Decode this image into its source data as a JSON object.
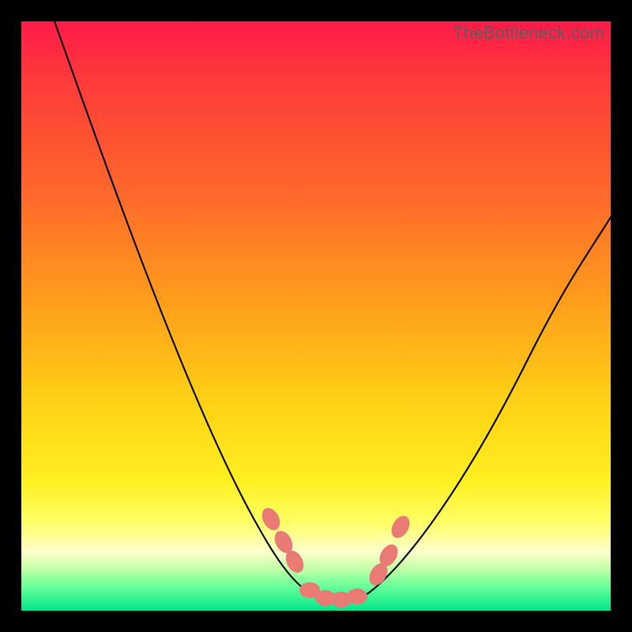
{
  "watermark": "TheBottleneck.com",
  "colors": {
    "background": "#000000",
    "curve": "#000000",
    "marker": "#ea7a74"
  },
  "chart_data": {
    "type": "line",
    "title": "",
    "xlabel": "",
    "ylabel": "",
    "xlim": [
      0,
      100
    ],
    "ylim": [
      0,
      100
    ],
    "series": [
      {
        "name": "curve",
        "x": [
          5,
          10,
          15,
          20,
          25,
          30,
          35,
          40,
          43,
          46,
          48,
          50,
          52,
          54,
          56,
          60,
          65,
          70,
          75,
          80,
          85,
          90,
          95,
          100
        ],
        "y": [
          100,
          88,
          77,
          66,
          55,
          44,
          33,
          22,
          15,
          10,
          6,
          3,
          2,
          2,
          3,
          5,
          10,
          17,
          25,
          33,
          42,
          50,
          58,
          68
        ]
      }
    ],
    "markers": [
      {
        "x": 42,
        "y": 14
      },
      {
        "x": 44,
        "y": 10
      },
      {
        "x": 46,
        "y": 7
      },
      {
        "x": 49,
        "y": 3
      },
      {
        "x": 51,
        "y": 2
      },
      {
        "x": 53,
        "y": 2
      },
      {
        "x": 55,
        "y": 3
      },
      {
        "x": 58,
        "y": 6
      },
      {
        "x": 60,
        "y": 10
      },
      {
        "x": 62,
        "y": 13
      }
    ]
  }
}
